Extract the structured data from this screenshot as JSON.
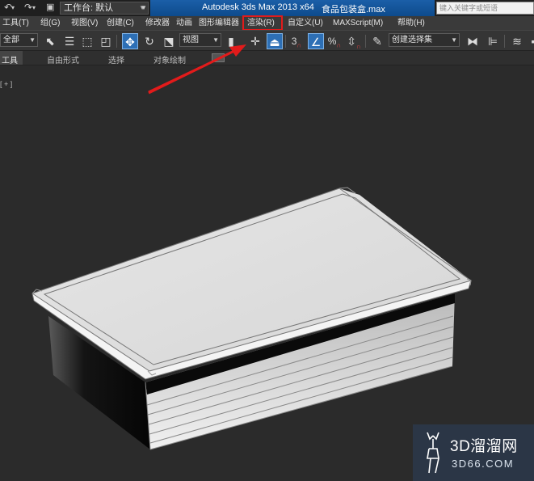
{
  "titlebar": {
    "workspace": "工作台: 默认",
    "app_title": "Autodesk 3ds Max  2013 x64",
    "file_name": "食品包装盒.max",
    "search_placeholder": "键入关键字或短语"
  },
  "menu": {
    "items": [
      "工具(T)",
      "组(G)",
      "视图(V)",
      "创建(C)",
      "修改器",
      "动画",
      "图形编辑器",
      "渲染(R)",
      "自定义(U)",
      "MAXScript(M)",
      "帮助(H)"
    ],
    "highlighted": "渲染(R)",
    "highlight_color": "#e21b1b"
  },
  "toolbar": {
    "selection_filter": "全部",
    "reference_coord": "视图",
    "angle_snap_label": "3",
    "percent_snap_label": "%",
    "named_selection_placeholder": "创建选择集",
    "active_color": "#2d6fb5"
  },
  "ribbon": {
    "tabs": [
      "工具",
      "自由形式",
      "选择",
      "对象绘制"
    ]
  },
  "viewport": {
    "label": "[ + ]",
    "object": "food-packaging-box"
  },
  "watermark": {
    "line1": "3D溜溜网",
    "line2": "3D66.COM"
  }
}
